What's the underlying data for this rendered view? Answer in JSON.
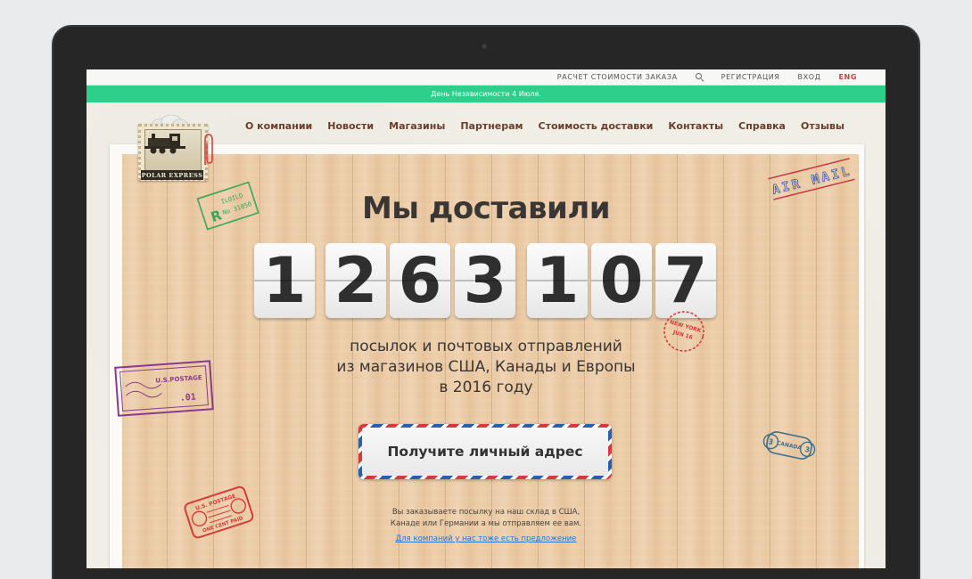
{
  "topbar": {
    "calc_label": "Расчет стоимости заказа",
    "register_label": "Регистрация",
    "login_label": "Вход",
    "lang_label": "ENG"
  },
  "announcement": "День Независимости 4 Июля.",
  "logo": {
    "brand": "POLAR EXPRESS"
  },
  "nav": {
    "items": [
      "О компании",
      "Новости",
      "Магазины",
      "Партнерам",
      "Стоимость доставки",
      "Контакты",
      "Справка",
      "Отзывы"
    ]
  },
  "hero": {
    "headline": "Мы доставили",
    "digits": [
      "1",
      "2",
      "6",
      "3",
      "1",
      "0",
      "7"
    ],
    "sub_line1": "посылок и почтовых отправлений",
    "sub_line2": "из магазинов США, Канады и Европы",
    "sub_line3": "в 2016 году",
    "cta_label": "Получите личный адрес",
    "note_line1": "Вы заказываете посылку на наш склад в США,",
    "note_line2": "Канаде или Германии а мы отправляем ее вам.",
    "company_link": "Для компаний у нас тоже есть предложение"
  },
  "stamps": {
    "airmail": "AIR MAIL",
    "green_stamp_line1": "ILOILO",
    "green_stamp_line2": "No 31850",
    "green_stamp_letter": "R",
    "us_postage": "U.S.POSTAGE",
    "us_postage_value": ".01",
    "red_postage": "U.S. POSTAGE",
    "red_postage_value": "ONE CENT PAID",
    "new_york": "NEW YORK",
    "new_york_date": "JUN 16",
    "canada": "CANADA",
    "canada_value": "3"
  },
  "colors": {
    "accent_green": "#2ecf8a",
    "nav_brown": "#6b3d2b",
    "lang_red": "#d23a3a",
    "link_blue": "#2b74c7"
  }
}
